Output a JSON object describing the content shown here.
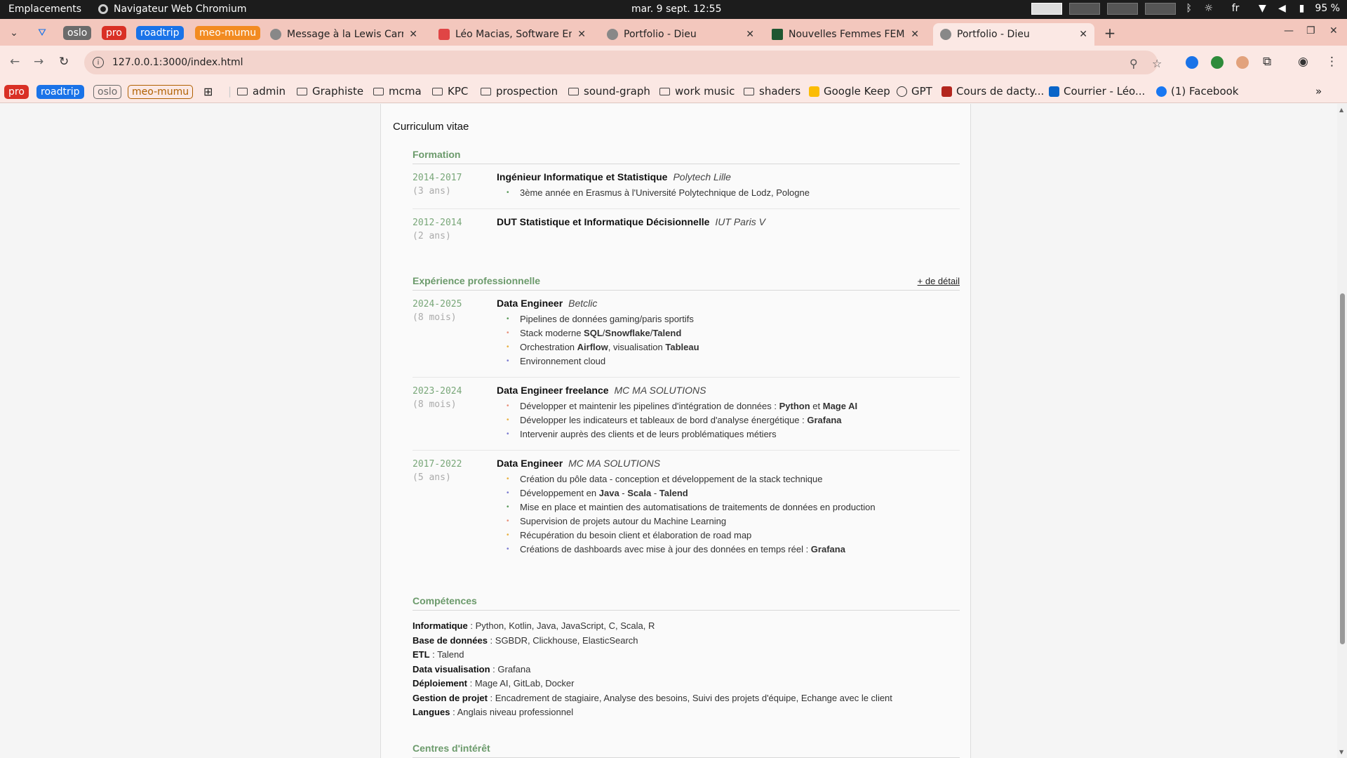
{
  "system": {
    "places": "Emplacements",
    "app_name": "Navigateur Web Chromium",
    "clock": "mar. 9 sept.  12:55",
    "lang": "fr",
    "battery": "95 %"
  },
  "tab_groups": [
    {
      "label": "oslo",
      "color": "#6b6b6b"
    },
    {
      "label": "pro",
      "color": "#d93025"
    },
    {
      "label": "roadtrip",
      "color": "#1a73e8"
    },
    {
      "label": "meo-mumu",
      "color": "#f28b21"
    }
  ],
  "tabs": [
    {
      "title": "Message à la Lewis Carroll",
      "favicon_color": "#888"
    },
    {
      "title": "Léo Macias, Software Engineer",
      "favicon_color": "#e04545"
    },
    {
      "title": "Portfolio - Dieu",
      "favicon_color": "#888"
    },
    {
      "title": "Nouvelles Femmes FEMA",
      "favicon_color": "#1e5631"
    },
    {
      "title": "Portfolio - Dieu",
      "favicon_color": "#888"
    }
  ],
  "address_bar": {
    "url": "127.0.0.1:3000/index.html"
  },
  "bookmarks": {
    "chips": [
      {
        "label": "pro",
        "color": "#d93025"
      },
      {
        "label": "roadtrip",
        "color": "#1a73e8"
      },
      {
        "label": "oslo",
        "color": "#6b6b6b"
      },
      {
        "label": "meo-mumu",
        "color": "#b06000"
      }
    ],
    "folders": [
      "admin",
      "Graphiste",
      "mcma",
      "KPC",
      "prospection",
      "sound-graph",
      "work music",
      "shaders"
    ],
    "links": [
      "Google Keep",
      "GPT",
      "Cours de dacty...",
      "Courrier - Léo...",
      "(1) Facebook"
    ]
  },
  "cv": {
    "title": "Curriculum vitae",
    "formation": {
      "heading": "Formation",
      "entries": [
        {
          "dates": "2014-2017",
          "duration": "(3 ans)",
          "role": "Ingénieur Informatique et Statistique",
          "org": "Polytech Lille",
          "bullets": [
            "3ème année en Erasmus à l'Université Polytechnique de Lodz, Pologne"
          ]
        },
        {
          "dates": "2012-2014",
          "duration": "(2 ans)",
          "role": "DUT Statistique et Informatique Décisionnelle",
          "org": "IUT Paris V",
          "bullets": []
        }
      ]
    },
    "experience": {
      "heading": "Expérience professionnelle",
      "detail_link": "+ de détail",
      "entries": [
        {
          "dates": "2024-2025",
          "duration": "(8 mois)",
          "role": "Data Engineer",
          "org": "Betclic",
          "bullets": [
            [
              {
                "t": "Pipelines de données gaming/paris sportifs"
              }
            ],
            [
              {
                "t": "Stack moderne "
              },
              {
                "t": "SQL",
                "b": true
              },
              {
                "t": "/"
              },
              {
                "t": "Snowflake",
                "b": true
              },
              {
                "t": "/"
              },
              {
                "t": "Talend",
                "b": true
              }
            ],
            [
              {
                "t": "Orchestration "
              },
              {
                "t": "Airflow",
                "b": true
              },
              {
                "t": ", visualisation "
              },
              {
                "t": "Tableau",
                "b": true
              }
            ],
            [
              {
                "t": "Environnement cloud"
              }
            ]
          ]
        },
        {
          "dates": "2023-2024",
          "duration": "(8 mois)",
          "role": "Data Engineer freelance",
          "org": "MC MA SOLUTIONS",
          "bullets": [
            [
              {
                "t": "Développer et maintenir les pipelines d'intégration de données : "
              },
              {
                "t": "Python",
                "b": true
              },
              {
                "t": " et "
              },
              {
                "t": "Mage AI",
                "b": true
              }
            ],
            [
              {
                "t": "Développer les indicateurs et tableaux de bord d'analyse énergétique : "
              },
              {
                "t": "Grafana",
                "b": true
              }
            ],
            [
              {
                "t": "Intervenir auprès des clients et de leurs problématiques métiers"
              }
            ]
          ]
        },
        {
          "dates": "2017-2022",
          "duration": "(5 ans)",
          "role": "Data Engineer",
          "org": "MC MA SOLUTIONS",
          "bullets": [
            [
              {
                "t": "Création du pôle data - conception et développement de la stack technique"
              }
            ],
            [
              {
                "t": "Développement en "
              },
              {
                "t": "Java",
                "b": true
              },
              {
                "t": " - "
              },
              {
                "t": "Scala",
                "b": true
              },
              {
                "t": " - "
              },
              {
                "t": "Talend",
                "b": true
              }
            ],
            [
              {
                "t": "Mise en place et maintien des automatisations de traitements de données en production"
              }
            ],
            [
              {
                "t": "Supervision de projets autour du Machine Learning"
              }
            ],
            [
              {
                "t": "Récupération du besoin client et élaboration de road map"
              }
            ],
            [
              {
                "t": "Créations de dashboards avec mise à jour des données en temps réel : "
              },
              {
                "t": "Grafana",
                "b": true
              }
            ]
          ]
        }
      ]
    },
    "skills": {
      "heading": "Compétences",
      "items": [
        {
          "label": "Informatique",
          "value": "Python, Kotlin, Java, JavaScript, C, Scala, R"
        },
        {
          "label": "Base de données",
          "value": "SGBDR, Clickhouse, ElasticSearch"
        },
        {
          "label": "ETL",
          "value": "Talend"
        },
        {
          "label": "Data visualisation",
          "value": "Grafana"
        },
        {
          "label": "Déploiement",
          "value": "Mage AI, GitLab, Docker"
        },
        {
          "label": "Gestion de projet",
          "value": "Encadrement de stagiaire, Analyse des besoins, Suivi des projets d'équipe, Echange avec le client"
        },
        {
          "label": "Langues",
          "value": "Anglais niveau professionnel"
        }
      ]
    },
    "interests": {
      "heading": "Centres d'intérêt"
    },
    "bullet_colors": [
      "#5a9a5a",
      "#e8907a",
      "#e8b040",
      "#7a7ad0"
    ]
  }
}
